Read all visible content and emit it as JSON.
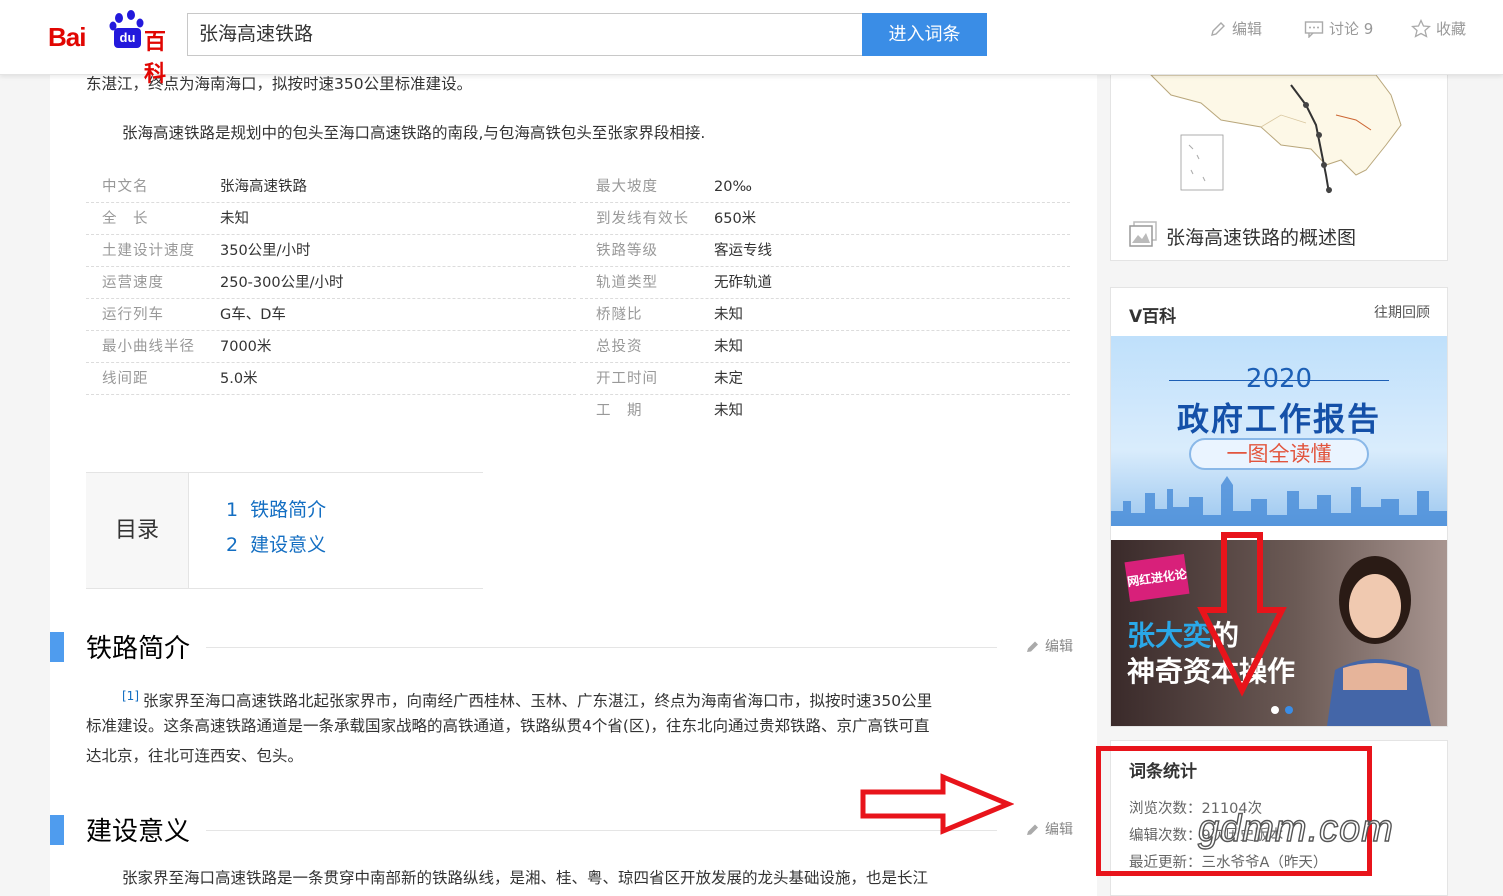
{
  "header": {
    "logo_text_bai": "Bai",
    "logo_text_du": "du",
    "logo_text_baike": "百科",
    "search_value": "张海高速铁路",
    "search_button": "进入词条",
    "actions": {
      "edit": "编辑",
      "discuss": "讨论 9",
      "favorite": "收藏"
    }
  },
  "article": {
    "top_fragment": "东湛江，终点为海南海口，拟按时速350公里标准建设。",
    "intro": "张海高速铁路是规划中的包头至海口高速铁路的南段,与包海高铁包头至张家界段相接.",
    "infobox_left": [
      {
        "key": "中文名",
        "value": "张海高速铁路"
      },
      {
        "key": "全　长",
        "value": "未知"
      },
      {
        "key": "土建设计速度",
        "value": "350公里/小时"
      },
      {
        "key": "运营速度",
        "value": "250-300公里/小时"
      },
      {
        "key": "运行列车",
        "value": "G车、D车"
      },
      {
        "key": "最小曲线半径",
        "value": "7000米"
      },
      {
        "key": "线间距",
        "value": "5.0米"
      }
    ],
    "infobox_right": [
      {
        "key": "最大坡度",
        "value": "20‰"
      },
      {
        "key": "到发线有效长",
        "value": "650米"
      },
      {
        "key": "铁路等级",
        "value": "客运专线"
      },
      {
        "key": "轨道类型",
        "value": "无砟轨道"
      },
      {
        "key": "桥隧比",
        "value": "未知"
      },
      {
        "key": "总投资",
        "value": "未知"
      },
      {
        "key": "开工时间",
        "value": "未定"
      },
      {
        "key": "工　期",
        "value": "未知"
      }
    ],
    "toc": {
      "label": "目录",
      "items": [
        {
          "num": "1",
          "title": "铁路简介"
        },
        {
          "num": "2",
          "title": "建设意义"
        }
      ]
    },
    "sections": [
      {
        "title": "铁路简介",
        "edit": "编辑",
        "ref": "[1]",
        "lines": [
          "张家界至海口高速铁路北起张家界市，向南经广西桂林、玉林、广东湛江，终点为海南省海口市，拟按时速350公里",
          "标准建设。这条高速铁路通道是一条承载国家战略的高铁通道，铁路纵贯4个省(区)，往东北向通过贵郑铁路、京广高铁可直",
          "达北京，往北可连西安、包头。"
        ]
      },
      {
        "title": "建设意义",
        "edit": "编辑",
        "lines": [
          "张家界至海口高速铁路是一条贯穿中南部新的铁路纵线，是湘、桂、粤、琼四省区开放发展的龙头基础设施，也是长江"
        ]
      }
    ]
  },
  "sidebar": {
    "map_caption": "张海高速铁路的概述图",
    "vbaike": {
      "title": "V百科",
      "more": "往期回顾",
      "banner1": {
        "year": "2020",
        "title": "政府工作报告",
        "sub": "一图全读懂"
      },
      "banner2": {
        "badge": "网红进化论",
        "line1_name": "张大奕",
        "line1_suffix": "的",
        "line2": "神奇资本操作"
      }
    },
    "stats": {
      "title": "词条统计",
      "views": "浏览次数：21104次",
      "edits": "编辑次数：9次历史版本",
      "updated": "最近更新：三水爷爷A（昨天）"
    }
  },
  "watermark": "gdmm.com",
  "annotation_color": "#e8141b"
}
